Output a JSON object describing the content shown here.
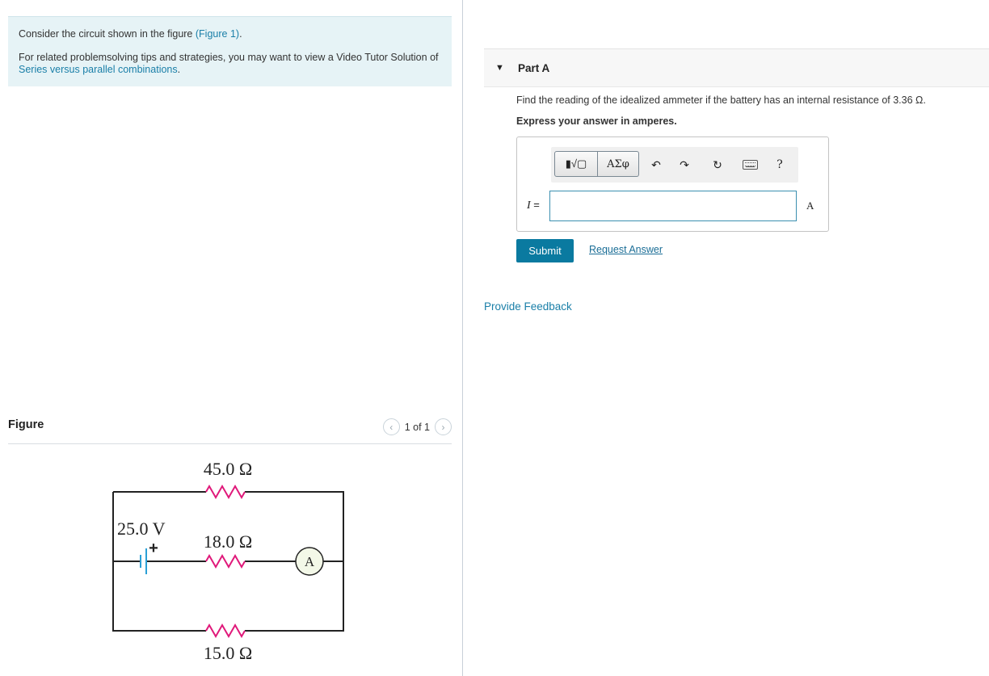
{
  "intro": {
    "line1_prefix": "Consider the circuit shown in the figure ",
    "line1_link": "(Figure 1)",
    "line1_suffix": ".",
    "line2_prefix": "For related problemsolving tips and strategies, you may want to view a Video Tutor Solution of ",
    "line2_link": "Series versus parallel combinations",
    "line2_suffix": "."
  },
  "figure": {
    "title": "Figure",
    "pager": "1 of 1",
    "prev_icon": "chevron-left-icon",
    "next_icon": "chevron-right-icon",
    "labels": {
      "r_top": "45.0 Ω",
      "r_mid": "18.0 Ω",
      "r_bot": "15.0 Ω",
      "battery": "25.0 V",
      "plus": "+",
      "ammeter": "A"
    },
    "colors": {
      "wire": "#222222",
      "resistor": "#e0197a",
      "battery": "#2aa0d6",
      "ammeter_fill": "#f3f8e8"
    }
  },
  "part": {
    "arrow_icon": "triangle-down-icon",
    "title": "Part A",
    "question": "Find the reading of the idealized ammeter if the battery has an internal resistance of 3.36 Ω.",
    "instruction": "Express your answer in amperes."
  },
  "toolbar": {
    "templates_label": "▮√▢",
    "greek_label": "ΑΣφ",
    "undo_icon": "undo-icon",
    "redo_icon": "redo-icon",
    "reset_icon": "reset-icon",
    "keyboard_icon": "keyboard-icon",
    "help_label": "?"
  },
  "answer": {
    "variable": "I",
    "equals": "=",
    "value": "",
    "unit": "A"
  },
  "actions": {
    "submit": "Submit",
    "request_answer": "Request Answer",
    "feedback": "Provide Feedback"
  }
}
